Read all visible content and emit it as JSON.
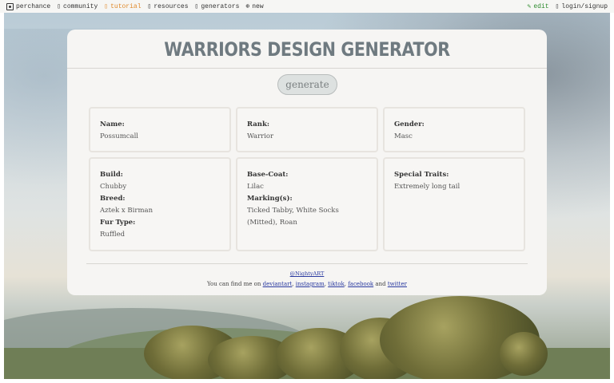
{
  "nav": {
    "brand": "perchance",
    "items": [
      {
        "label": "community",
        "icon": "chat-icon"
      },
      {
        "label": "tutorial",
        "icon": "book-icon"
      },
      {
        "label": "resources",
        "icon": "link-icon"
      },
      {
        "label": "generators",
        "icon": "grid-icon"
      },
      {
        "label": "new",
        "icon": "plus-circle-icon"
      }
    ],
    "edit_label": "edit",
    "login_label": "login/signup",
    "colors": {
      "tutorial": "#e08a2c",
      "edit": "#2e8b2e"
    }
  },
  "card": {
    "title": "Warriors Design Generator",
    "generate_label": "generate",
    "fields": {
      "name": {
        "label": "Name:",
        "value": "Possumcall"
      },
      "rank": {
        "label": "Rank:",
        "value": "Warrior"
      },
      "gender": {
        "label": "Gender:",
        "value": "Masc"
      },
      "build": {
        "label": "Build:",
        "value": "Chubby"
      },
      "breed": {
        "label": "Breed:",
        "value": "Aztek x Birman"
      },
      "fur_type": {
        "label": "Fur Type:",
        "value": "Ruffled"
      },
      "base_coat": {
        "label": "Base-Coat:",
        "value": "Lilac"
      },
      "markings": {
        "label": "Marking(s):",
        "value": "Ticked Tabby, White Socks (Mitted), Roan"
      },
      "special_traits": {
        "label": "Special Traits:",
        "value": "Extremely long tail"
      }
    }
  },
  "footer": {
    "handle": "@NightyART",
    "prefix": "You can find me on",
    "links": [
      "deviantart",
      "instagram",
      "tiktok",
      "facebook"
    ],
    "and_text": "and",
    "last_link": "twitter"
  }
}
